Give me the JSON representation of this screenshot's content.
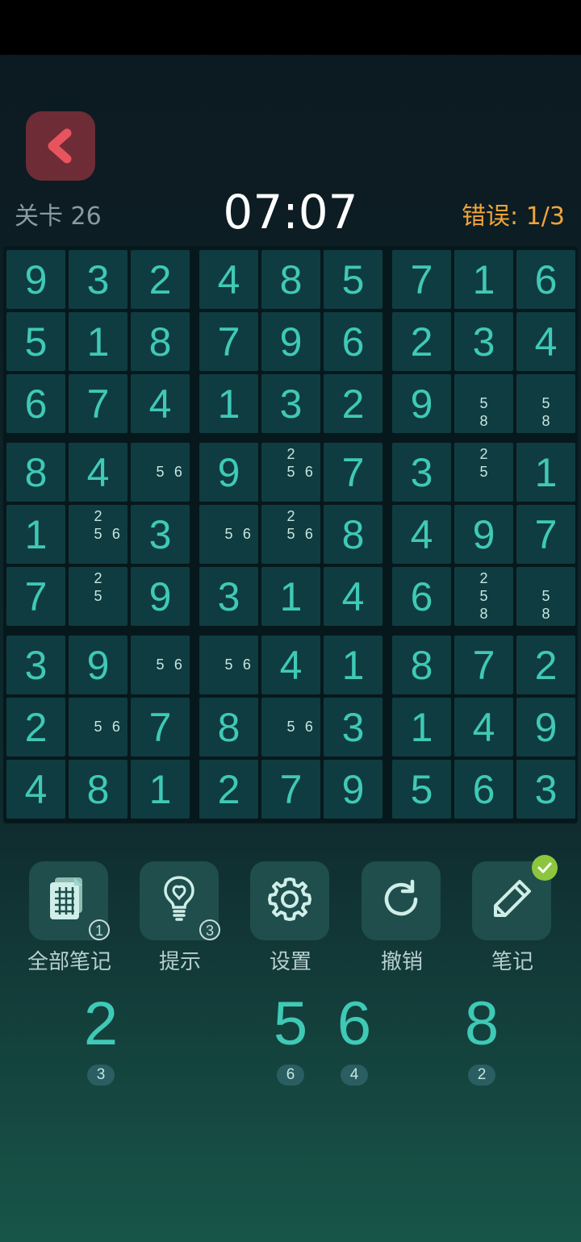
{
  "header": {
    "level": "关卡 26",
    "timer": "07:07",
    "errors": "错误: 1/3"
  },
  "colors": {
    "accent": "#3fc9b6",
    "error": "#f2a33a",
    "back": "#6e2c36",
    "check": "#8cc63f"
  },
  "board": [
    [
      9,
      3,
      2,
      4,
      8,
      5,
      7,
      1,
      6
    ],
    [
      5,
      1,
      8,
      7,
      9,
      6,
      2,
      3,
      4
    ],
    [
      6,
      7,
      4,
      1,
      3,
      2,
      9,
      null,
      null
    ],
    [
      8,
      4,
      null,
      9,
      null,
      7,
      3,
      null,
      1
    ],
    [
      1,
      null,
      3,
      null,
      null,
      8,
      4,
      9,
      7
    ],
    [
      7,
      null,
      9,
      3,
      1,
      4,
      6,
      null,
      null
    ],
    [
      3,
      9,
      null,
      null,
      4,
      1,
      8,
      7,
      2
    ],
    [
      2,
      null,
      7,
      8,
      null,
      3,
      1,
      4,
      9
    ],
    [
      4,
      8,
      1,
      2,
      7,
      9,
      5,
      6,
      3
    ]
  ],
  "notes": {
    "2,7": [
      5,
      8
    ],
    "2,8": [
      5,
      8
    ],
    "3,2": [
      5,
      6
    ],
    "3,4": [
      2,
      5,
      6
    ],
    "3,7": [
      2,
      5
    ],
    "4,1": [
      2,
      5,
      6
    ],
    "4,3": [
      5,
      6
    ],
    "4,4": [
      2,
      5,
      6
    ],
    "5,1": [
      2,
      5
    ],
    "5,7": [
      2,
      5,
      8
    ],
    "5,8": [
      5,
      8
    ],
    "6,2": [
      5,
      6
    ],
    "6,3": [
      5,
      6
    ],
    "7,1": [
      5,
      6
    ],
    "7,4": [
      5,
      6
    ]
  },
  "tools": [
    {
      "label": "全部笔记",
      "icon": "notes-all-icon",
      "badge": "1"
    },
    {
      "label": "提示",
      "icon": "hint-bulb-icon",
      "badge": "3"
    },
    {
      "label": "设置",
      "icon": "gear-icon",
      "badge": ""
    },
    {
      "label": "撤销",
      "icon": "undo-icon",
      "badge": ""
    },
    {
      "label": "笔记",
      "icon": "pencil-icon",
      "badge": "",
      "checked": true
    }
  ],
  "numpad": [
    {
      "digit": "2",
      "count": "3"
    },
    {
      "digit": "5",
      "count": "6"
    },
    {
      "digit": "6",
      "count": "4"
    },
    {
      "digit": "8",
      "count": "2"
    }
  ]
}
